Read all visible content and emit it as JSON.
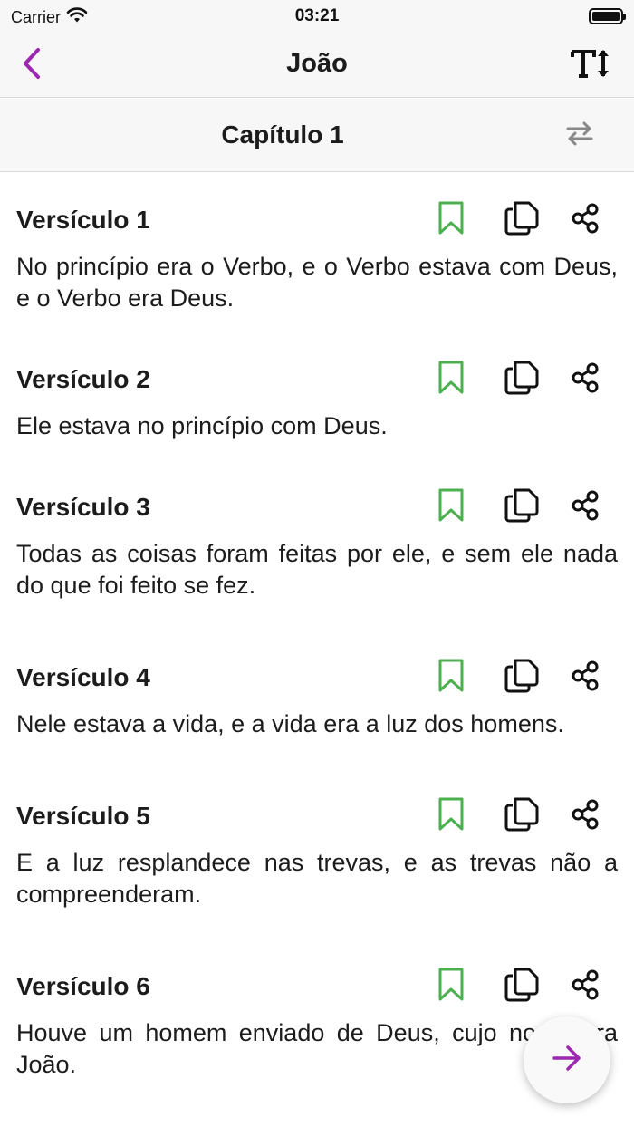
{
  "status": {
    "carrier": "Carrier",
    "time": "03:21"
  },
  "nav": {
    "title": "João",
    "back_icon": "chevron-left-icon",
    "font_icon": "text-size-icon",
    "accent_color": "#9c27b0"
  },
  "chapter": {
    "title": "Capítulo 1",
    "swap_icon": "swap-icon"
  },
  "verses": [
    {
      "label": "Versículo 1",
      "text": "No princípio era o Verbo, e o Verbo estava com Deus, e o Verbo era Deus."
    },
    {
      "label": "Versículo 2",
      "text": "Ele estava no princípio com Deus."
    },
    {
      "label": "Versículo 3",
      "text": "Todas as coisas foram feitas por ele, e sem ele nada do que foi feito se fez."
    },
    {
      "label": "Versículo 4",
      "text": "Nele estava a vida, e a vida era a luz dos homens."
    },
    {
      "label": "Versículo 5",
      "text": "E a luz resplandece nas trevas, e as trevas não a compreenderam."
    },
    {
      "label": "Versículo 6",
      "text": "Houve um homem enviado de Deus, cujo nome era João."
    }
  ],
  "colors": {
    "bookmark": "#4caf50",
    "icon": "#111111",
    "accent": "#9c27b0"
  },
  "fab": {
    "icon": "arrow-right-icon"
  }
}
